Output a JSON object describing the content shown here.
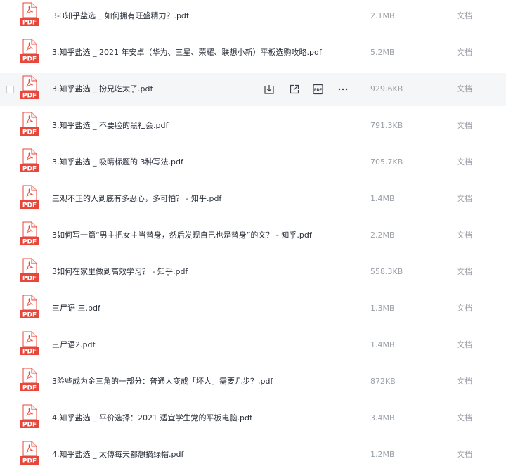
{
  "files": [
    {
      "name": "3-3知乎盐选 _ 如何拥有旺盛精力？.pdf",
      "size": "2.1MB",
      "type": "文档",
      "icon": "pdf-file-icon",
      "icon_label": "PDF",
      "hovered": false
    },
    {
      "name": "3.知乎盐选 _ 2021 年安卓（华为、三星、荣耀、联想小新）平板选购攻略.pdf",
      "size": "5.2MB",
      "type": "文档",
      "icon": "pdf-file-icon",
      "icon_label": "PDF",
      "hovered": false
    },
    {
      "name": "3.知乎盐选 _ 扮兄吃太子.pdf",
      "size": "929.6KB",
      "type": "文档",
      "icon": "pdf-file-icon",
      "icon_label": "PDF",
      "hovered": true
    },
    {
      "name": "3.知乎盐选 _ 不要脸的黑社会.pdf",
      "size": "791.3KB",
      "type": "文档",
      "icon": "pdf-file-icon",
      "icon_label": "PDF",
      "hovered": false
    },
    {
      "name": "3.知乎盐选 _ 吸睛标题的 3种写法.pdf",
      "size": "705.7KB",
      "type": "文档",
      "icon": "pdf-file-icon",
      "icon_label": "PDF",
      "hovered": false
    },
    {
      "name": "三观不正的人到底有多恶心，多可怕？ - 知乎.pdf",
      "size": "1.4MB",
      "type": "文档",
      "icon": "pdf-file-icon",
      "icon_label": "PDF",
      "hovered": false
    },
    {
      "name": "3如何写一篇“男主把女主当替身，然后发现自己也是替身”的文？ - 知乎.pdf",
      "size": "2.2MB",
      "type": "文档",
      "icon": "pdf-file-icon",
      "icon_label": "PDF",
      "hovered": false
    },
    {
      "name": "3如何在家里做到高效学习？ - 知乎.pdf",
      "size": "558.3KB",
      "type": "文档",
      "icon": "pdf-file-icon",
      "icon_label": "PDF",
      "hovered": false
    },
    {
      "name": "三尸语 三.pdf",
      "size": "1.3MB",
      "type": "文档",
      "icon": "pdf-file-icon",
      "icon_label": "PDF",
      "hovered": false
    },
    {
      "name": "三尸语2.pdf",
      "size": "1.4MB",
      "type": "文档",
      "icon": "pdf-file-icon",
      "icon_label": "PDF",
      "hovered": false
    },
    {
      "name": "3险些成为金三角的一部分：普通人变成「坏人」需要几步？.pdf",
      "size": "872KB",
      "type": "文档",
      "icon": "pdf-file-icon",
      "icon_label": "PDF",
      "hovered": false
    },
    {
      "name": "4.知乎盐选 _ 平价选择：2021 适宜学生党的平板电脑.pdf",
      "size": "3.4MB",
      "type": "文档",
      "icon": "pdf-file-icon",
      "icon_label": "PDF",
      "hovered": false
    },
    {
      "name": "4.知乎盐选 _ 太傅每天都想摘绿帽.pdf",
      "size": "1.2MB",
      "type": "文档",
      "icon": "pdf-file-icon",
      "icon_label": "PDF",
      "hovered": false
    }
  ],
  "hover_actions": [
    {
      "icon": "download-icon"
    },
    {
      "icon": "share-icon"
    },
    {
      "icon": "pdf-tool-icon",
      "label": "PDF"
    },
    {
      "icon": "more-icon"
    }
  ],
  "colors": {
    "pdf_red": "#e8463a",
    "hover_bg": "#f5f6f8",
    "name_text": "#2a2f3a",
    "meta_text": "#9aa0a8"
  }
}
